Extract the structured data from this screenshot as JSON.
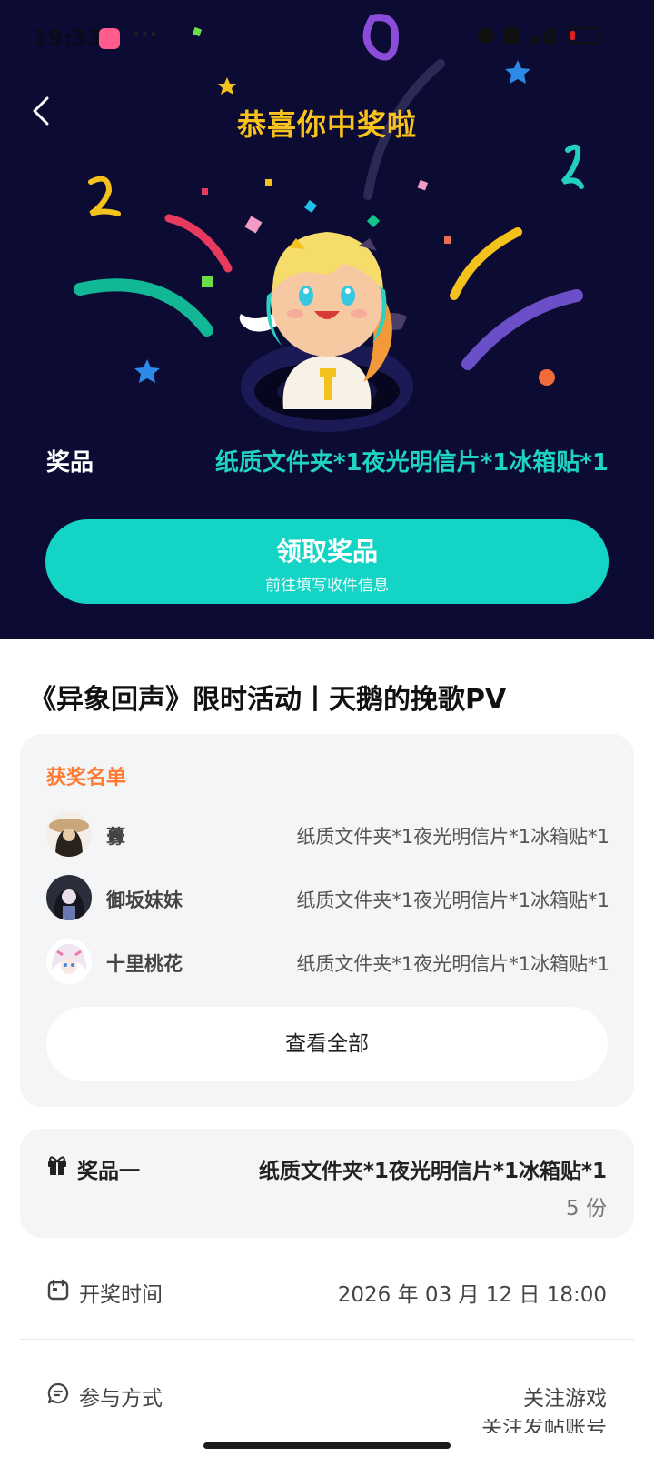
{
  "status_bar": {
    "time": "19:33",
    "dots": "···"
  },
  "hero": {
    "title": "恭喜你中奖啦",
    "prize_label": "奖品",
    "prize_value": "纸质文件夹*1夜光明信片*1冰箱贴*1",
    "claim_button": {
      "label": "领取奖品",
      "sublabel": "前往填写收件信息"
    },
    "colors": {
      "background": "#0c0b33",
      "title": "#f9c21c",
      "accent": "#14d4c6"
    }
  },
  "event_title": "《异象回声》限时活动丨天鹅的挽歌PV",
  "winners": {
    "heading": "获奖名单",
    "items": [
      {
        "name": "虋",
        "prize": "纸质文件夹*1夜光明信片*1冰箱贴*1"
      },
      {
        "name": "御坂妹妹",
        "prize": "纸质文件夹*1夜光明信片*1冰箱贴*1"
      },
      {
        "name": "十里桃花",
        "prize": "纸质文件夹*1夜光明信片*1冰箱贴*1"
      }
    ],
    "view_all": "查看全部"
  },
  "prize_tier": {
    "label": "奖品一",
    "items": "纸质文件夹*1夜光明信片*1冰箱贴*1",
    "quantity": "5 份"
  },
  "draw_time": {
    "label": "开奖时间",
    "value": "2026 年 03 月 12 日 18:00"
  },
  "participation": {
    "label": "参与方式",
    "value": "关注游戏",
    "value_cut": "关注发帖账号"
  }
}
